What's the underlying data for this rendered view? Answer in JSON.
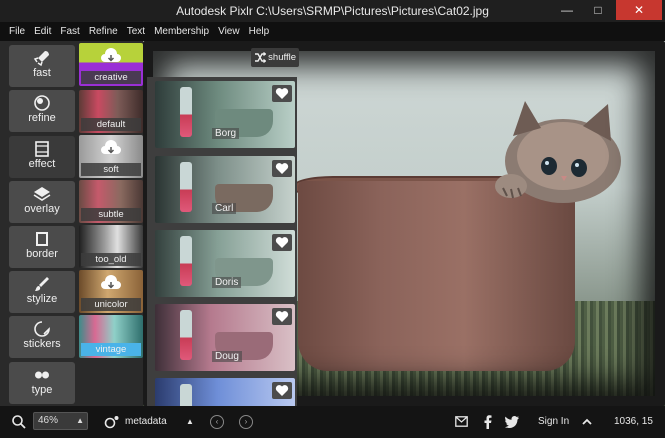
{
  "window": {
    "title": "Autodesk Pixlr  C:\\Users\\SRMP\\Pictures\\Pictures\\Cat02.jpg",
    "minimize": "—",
    "maximize": "□",
    "close": "✕"
  },
  "menu": [
    "File",
    "Edit",
    "Fast",
    "Refine",
    "Text",
    "Membership",
    "View",
    "Help"
  ],
  "categories": [
    {
      "label": "fast",
      "icon": "rocket-icon"
    },
    {
      "label": "refine",
      "icon": "refine-icon"
    },
    {
      "label": "effect",
      "icon": "film-icon"
    },
    {
      "label": "overlay",
      "icon": "layers-icon"
    },
    {
      "label": "border",
      "icon": "border-icon"
    },
    {
      "label": "stylize",
      "icon": "brush-icon"
    },
    {
      "label": "stickers",
      "icon": "sticker-icon"
    },
    {
      "label": "type",
      "icon": "quote-icon"
    }
  ],
  "active_category": "effect",
  "filters": [
    {
      "label": "creative",
      "colors": [
        "#b7d23a",
        "#9a2fd6"
      ]
    },
    {
      "label": "default",
      "colors": [
        "#5d3b37",
        "#c94a61"
      ]
    },
    {
      "label": "soft",
      "colors": [
        "#9a9a9a",
        "#d4d4d4"
      ]
    },
    {
      "label": "subtle",
      "colors": [
        "#6a4b44",
        "#c55a6b"
      ]
    },
    {
      "label": "too_old",
      "colors": [
        "#202020",
        "#9b9b9b"
      ]
    },
    {
      "label": "unicolor",
      "colors": [
        "#6c4b2a",
        "#d0a870"
      ]
    },
    {
      "label": "vintage",
      "colors": [
        "#3d8c89",
        "#8fd0c8"
      ]
    }
  ],
  "selected_filter": "vintage",
  "presets": [
    {
      "name": "Borg"
    },
    {
      "name": "Carl"
    },
    {
      "name": "Doris"
    },
    {
      "name": "Doug"
    },
    {
      "name": ""
    }
  ],
  "shuffle_label": "shuffle",
  "bottom": {
    "zoom": "46%",
    "metadata": "metadata",
    "sign_in": "Sign In",
    "coords": "1036, 15"
  }
}
